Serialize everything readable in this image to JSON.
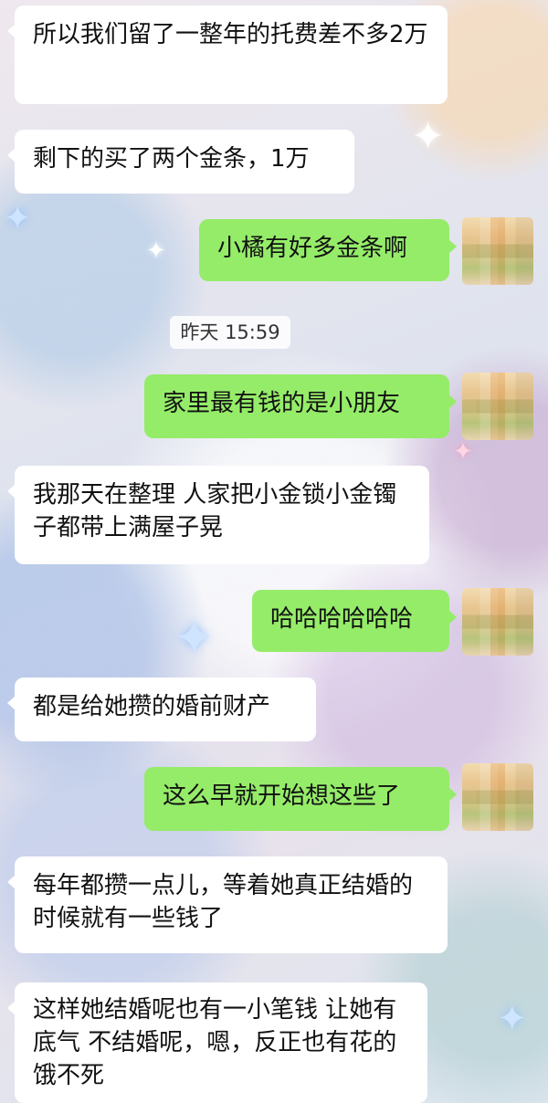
{
  "chat": {
    "timestamp": "昨天 15:59",
    "messages": [
      {
        "side": "in",
        "text": "所以我们留了一整年的托费差不多2万"
      },
      {
        "side": "in",
        "text": "剩下的买了两个金条，1万"
      },
      {
        "side": "out",
        "text": "小橘有好多金条啊"
      },
      {
        "side": "out",
        "text": "家里最有钱的是小朋友"
      },
      {
        "side": "in",
        "text": "我那天在整理 人家把小金锁小金镯子都带上满屋子晃"
      },
      {
        "side": "out",
        "text": "哈哈哈哈哈哈"
      },
      {
        "side": "in",
        "text": "都是给她攒的婚前财产"
      },
      {
        "side": "out",
        "text": "这么早就开始想这些了"
      },
      {
        "side": "in",
        "text": "每年都攒一点儿，等着她真正结婚的时候就有一些钱了"
      },
      {
        "side": "in",
        "text": "这样她结婚呢也有一小笔钱 让她有底气 不结婚呢，嗯，反正也有花的饿不死"
      }
    ]
  },
  "colors": {
    "outgoing_bubble": "#95ec69",
    "incoming_bubble": "#ffffff"
  },
  "icons": {
    "avatar": "blurred-avatar",
    "sparkle": "four-point-star"
  }
}
